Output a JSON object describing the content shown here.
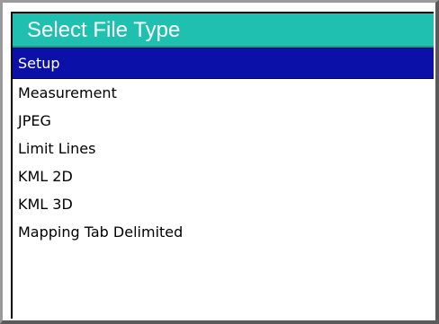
{
  "dialog": {
    "title": "Select File Type",
    "selected_index": 0,
    "items": [
      {
        "label": "Setup"
      },
      {
        "label": "Measurement"
      },
      {
        "label": "JPEG"
      },
      {
        "label": "Limit Lines"
      },
      {
        "label": "KML 2D"
      },
      {
        "label": "KML 3D"
      },
      {
        "label": "Mapping Tab Delimited"
      }
    ]
  },
  "colors": {
    "title_bg": "#20c0b0",
    "selection_bg": "#0a10a8"
  }
}
